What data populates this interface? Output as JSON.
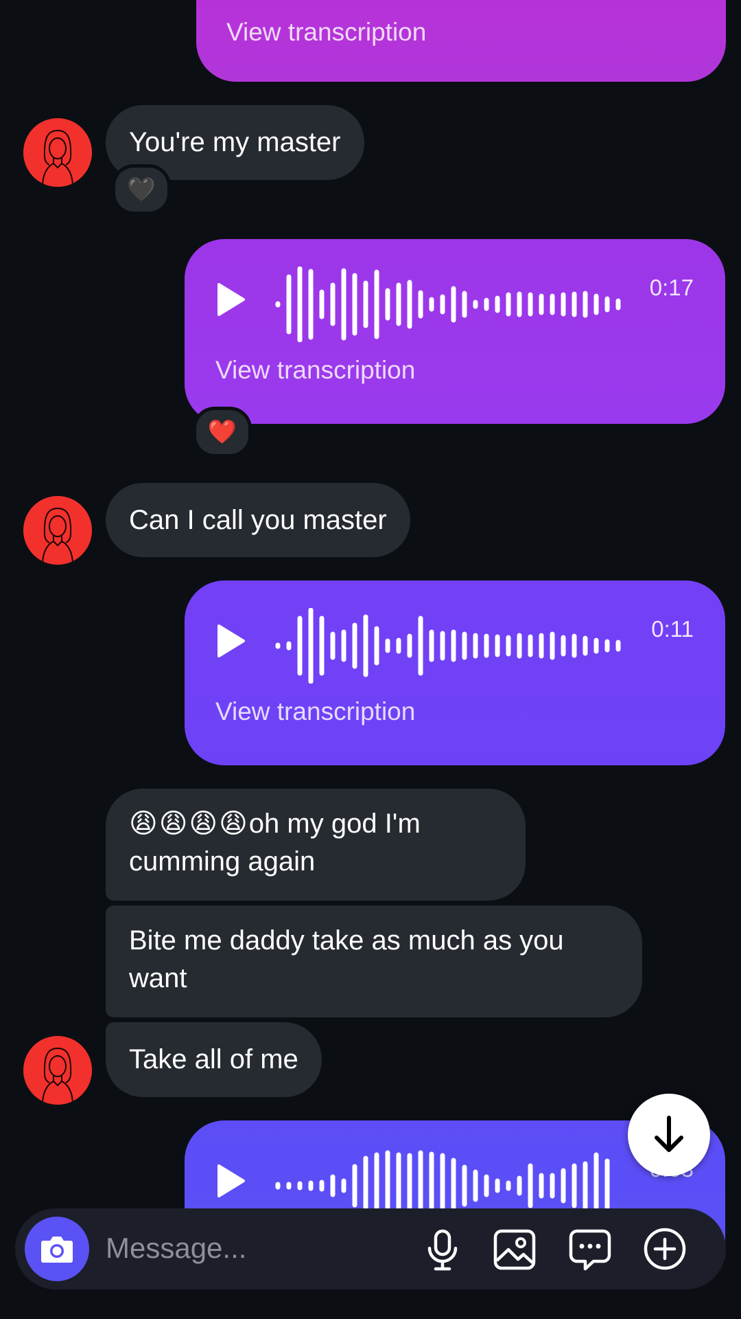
{
  "messages": {
    "voice_top": {
      "transcription_label": "View transcription"
    },
    "msg1": {
      "text": "You're my master",
      "reaction": "🖤"
    },
    "voice1": {
      "duration": "0:17",
      "transcription_label": "View transcription",
      "reaction": "❤️"
    },
    "msg2": {
      "text": "Can I call you master"
    },
    "voice2": {
      "duration": "0:11",
      "transcription_label": "View transcription"
    },
    "msg3": {
      "emojis": "😩😩😩😩",
      "text": "oh my god I'm cumming again"
    },
    "msg4": {
      "text": "Bite me daddy take as much as you want"
    },
    "msg5": {
      "text": "Take all of me"
    },
    "voice3": {
      "duration": "0:03"
    }
  },
  "composer": {
    "placeholder": "Message..."
  },
  "icons": {
    "camera": "camera-icon",
    "microphone": "microphone-icon",
    "gallery": "image-icon",
    "chat": "chat-bubble-icon",
    "add": "plus-circle-icon",
    "scroll": "arrow-down-icon",
    "play": "play-icon",
    "avatar": "avatar-icon"
  },
  "colors": {
    "background": "#0b0f14",
    "incoming_bubble": "#262a31",
    "voice_top": "#b433d8",
    "voice1": "#9b38ec",
    "voice2": "#7040f6",
    "voice3": "#5c4ef6",
    "avatar": "#f2312c",
    "camera_button": "#5b52f5"
  }
}
